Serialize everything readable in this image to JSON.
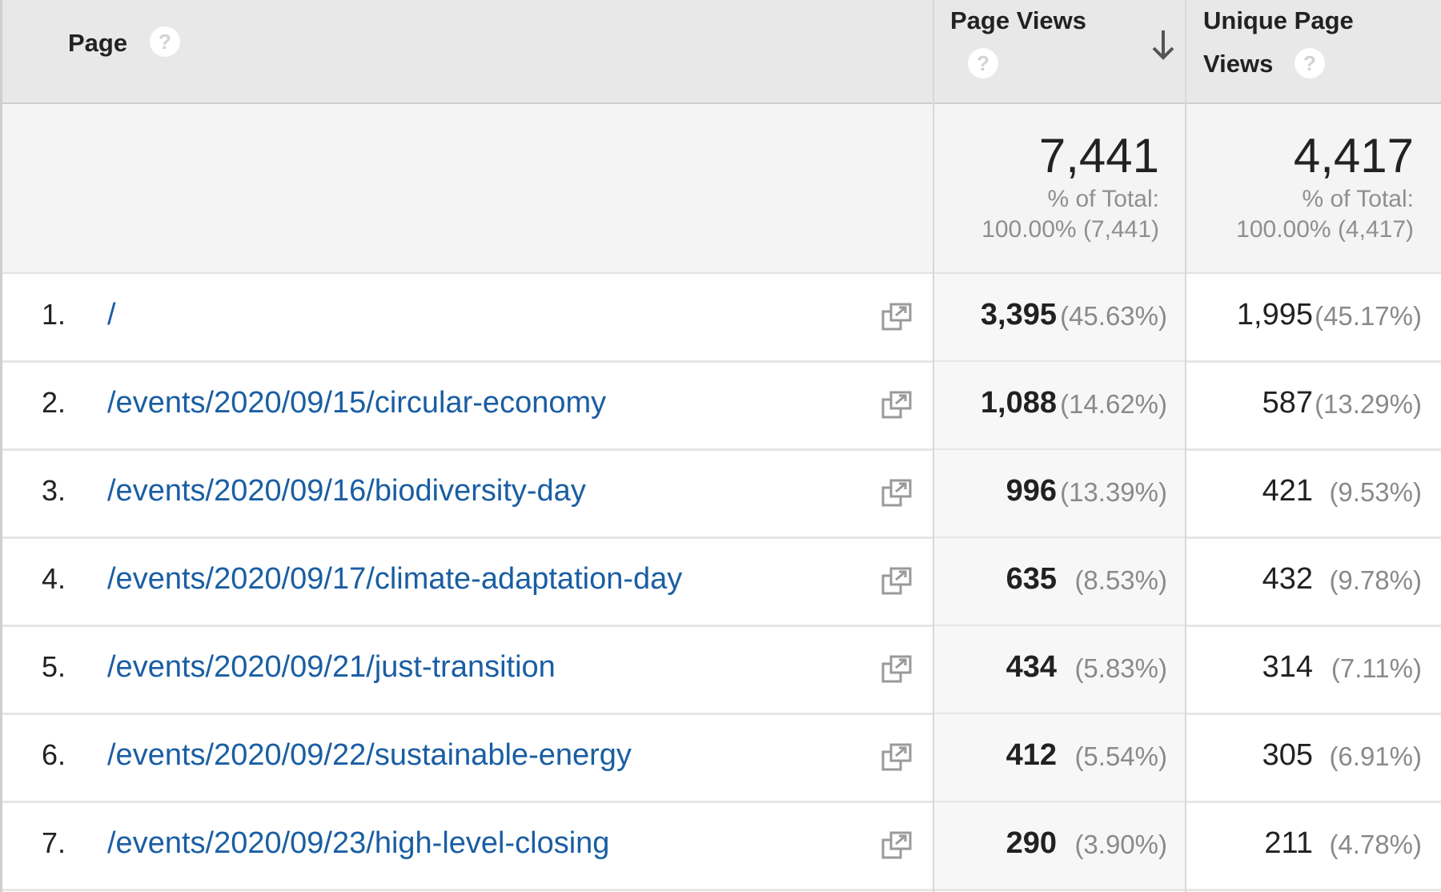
{
  "header": {
    "page_label": "Page",
    "page_views_label": "Page Views",
    "unique_page_views_line1": "Unique Page",
    "unique_page_views_line2": "Views",
    "help_glyph": "?"
  },
  "totals": {
    "page_views": {
      "value": "7,441",
      "sub1": "% of Total:",
      "sub2": "100.00% (7,441)"
    },
    "unique_page_views": {
      "value": "4,417",
      "sub1": "% of Total:",
      "sub2": "100.00% (4,417)"
    }
  },
  "rows": [
    {
      "num": "1.",
      "page": "/",
      "pv": "3,395",
      "pv_pct": "(45.63%)",
      "upv": "1,995",
      "upv_pct": "(45.17%)"
    },
    {
      "num": "2.",
      "page": "/events/2020/09/15/circular-economy",
      "pv": "1,088",
      "pv_pct": "(14.62%)",
      "upv": "587",
      "upv_pct": "(13.29%)"
    },
    {
      "num": "3.",
      "page": "/events/2020/09/16/biodiversity-day",
      "pv": "996",
      "pv_pct": "(13.39%)",
      "upv": "421",
      "upv_pct": "(9.53%)"
    },
    {
      "num": "4.",
      "page": "/events/2020/09/17/climate-adaptation-day",
      "pv": "635",
      "pv_pct": "(8.53%)",
      "upv": "432",
      "upv_pct": "(9.78%)"
    },
    {
      "num": "5.",
      "page": "/events/2020/09/21/just-transition",
      "pv": "434",
      "pv_pct": "(5.83%)",
      "upv": "314",
      "upv_pct": "(7.11%)"
    },
    {
      "num": "6.",
      "page": "/events/2020/09/22/sustainable-energy",
      "pv": "412",
      "pv_pct": "(5.54%)",
      "upv": "305",
      "upv_pct": "(6.91%)"
    },
    {
      "num": "7.",
      "page": "/events/2020/09/23/high-level-closing",
      "pv": "290",
      "pv_pct": "(3.90%)",
      "upv": "211",
      "upv_pct": "(4.78%)"
    }
  ],
  "icons": {
    "help": "help-circle-icon",
    "sort": "arrow-down-icon",
    "open": "open-in-new-window-icon"
  },
  "colors": {
    "link": "#1a5ea3",
    "header_bg": "#e8e8e8",
    "totals_bg": "#f4f4f4",
    "muted": "#8a8a8a"
  }
}
